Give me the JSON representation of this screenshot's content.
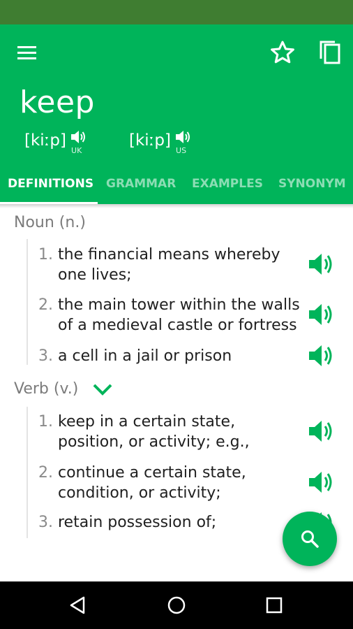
{
  "header": {
    "word": "keep",
    "pronunciations": [
      {
        "ipa": "[kiːp]",
        "region": "UK"
      },
      {
        "ipa": "[kiːp]",
        "region": "US"
      }
    ]
  },
  "tabs": [
    {
      "label": "DEFINITIONS",
      "active": true
    },
    {
      "label": "GRAMMAR",
      "active": false
    },
    {
      "label": "EXAMPLES",
      "active": false
    },
    {
      "label": "SYNONYM",
      "active": false
    }
  ],
  "sections": [
    {
      "heading": "Noun (n.)",
      "definitions": [
        {
          "num": "1.",
          "text": "the financial means whereby one lives;"
        },
        {
          "num": "2.",
          "text": "the main tower within the walls of a medieval castle or fortress"
        },
        {
          "num": "3.",
          "text": "a cell in a jail or prison"
        }
      ]
    },
    {
      "heading": "Verb (v.)",
      "definitions": [
        {
          "num": "1.",
          "text": "keep in a certain state, position, or activity; e.g.,"
        },
        {
          "num": "2.",
          "text": "continue a certain state, condition, or activity;"
        },
        {
          "num": "3.",
          "text": "retain possession of;"
        }
      ]
    }
  ],
  "icons": {
    "menu": "menu-icon",
    "favorite": "star-outline-icon",
    "copy": "copy-icon",
    "speaker": "speaker-icon",
    "expand": "chevron-down-icon",
    "search": "search-icon"
  },
  "colors": {
    "primary": "#00b45a",
    "status_bar": "#3f7d31",
    "heading_text": "#7b7b7b",
    "body_text": "#1f1f1f"
  }
}
